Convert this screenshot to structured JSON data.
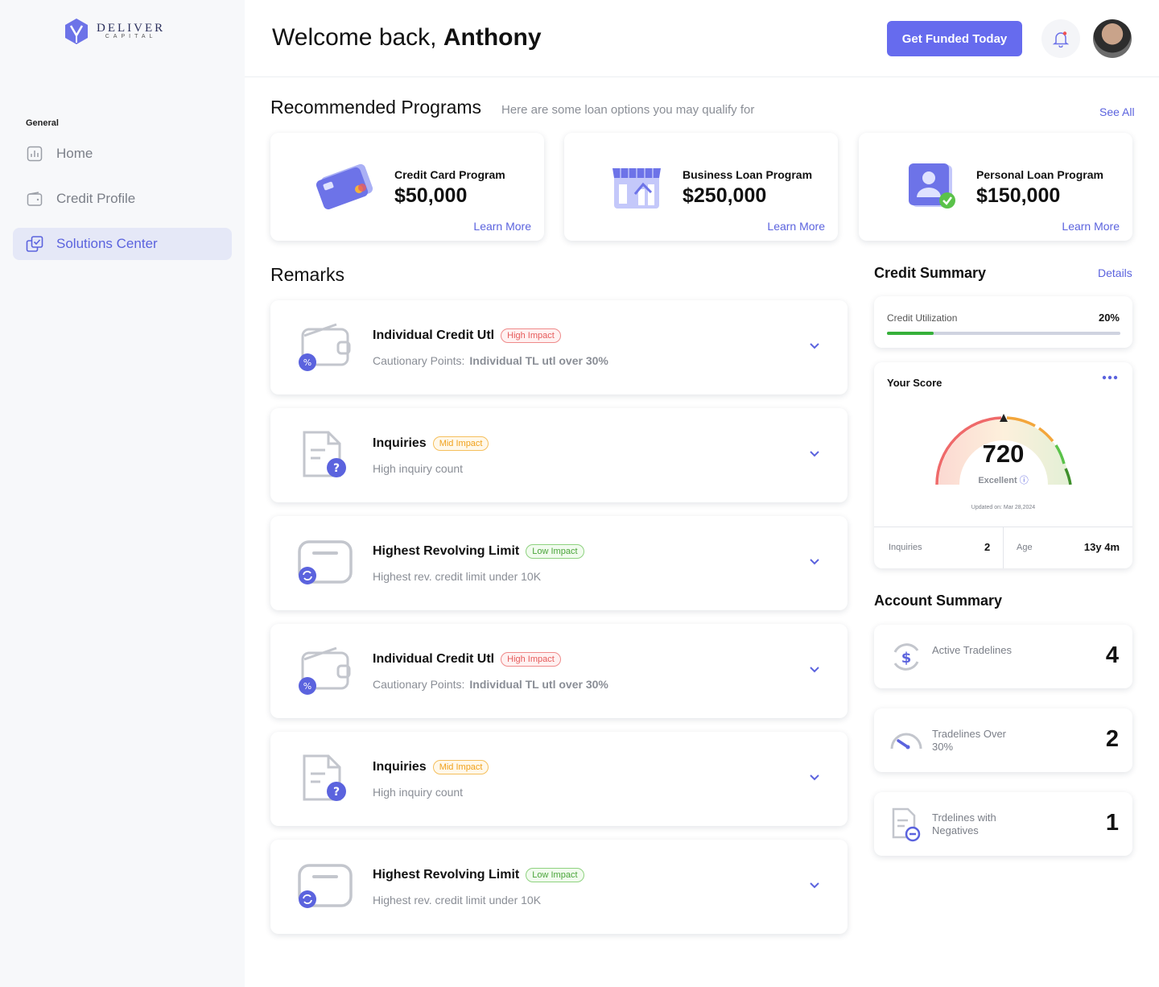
{
  "brand": {
    "name": "DELIVER",
    "sub": "CAPITAL"
  },
  "sidebar": {
    "section": "General",
    "items": [
      {
        "label": "Home",
        "icon": "chart-icon"
      },
      {
        "label": "Credit Profile",
        "icon": "wallet-icon"
      },
      {
        "label": "Solutions Center",
        "icon": "solutions-icon",
        "active": true
      }
    ]
  },
  "header": {
    "welcome": "Welcome back, ",
    "user": "Anthony",
    "cta": "Get Funded Today"
  },
  "programs": {
    "title": "Recommended Programs",
    "subtitle": "Here are some loan options you may qualify for",
    "see_all": "See All",
    "items": [
      {
        "name": "Credit Card Program",
        "amount": "$50,000",
        "link": "Learn More"
      },
      {
        "name": "Business Loan Program",
        "amount": "$250,000",
        "link": "Learn More"
      },
      {
        "name": "Personal Loan Program",
        "amount": "$150,000",
        "link": "Learn More"
      }
    ]
  },
  "remarks": {
    "title": "Remarks",
    "items": [
      {
        "title": "Individual Credit Utl",
        "badge": "High Impact",
        "prefix": "Cautionary Points:",
        "detail": "Individual TL utl over 30%"
      },
      {
        "title": "Inquiries",
        "badge": "Mid Impact",
        "detail": "High inquiry count"
      },
      {
        "title": "Highest Revolving Limit",
        "badge": "Low Impact",
        "detail": "Highest rev. credit limit under 10K"
      },
      {
        "title": "Individual Credit Utl",
        "badge": "High Impact",
        "prefix": "Cautionary Points:",
        "detail": "Individual TL utl over 30%"
      },
      {
        "title": "Inquiries",
        "badge": "Mid Impact",
        "detail": "High inquiry count"
      },
      {
        "title": "Highest Revolving Limit",
        "badge": "Low Impact",
        "detail": "Highest rev. credit limit under 10K"
      }
    ]
  },
  "credit_summary": {
    "title": "Credit Summary",
    "details": "Details",
    "utilization_label": "Credit Utilization",
    "utilization_value": "20%",
    "utilization_fraction": 0.2,
    "score_label": "Your Score",
    "score": "720",
    "rating": "Excellent",
    "updated": "Updated on: Mar 28,2024",
    "inquiries_label": "Inquiries",
    "inquiries": "2",
    "age_label": "Age",
    "age": "13y 4m"
  },
  "account_summary": {
    "title": "Account Summary",
    "items": [
      {
        "label": "Active Tradelines",
        "value": "4"
      },
      {
        "label": "Tradelines Over 30%",
        "value": "2"
      },
      {
        "label": "Trdelines with Negatives",
        "value": "1"
      }
    ]
  },
  "colors": {
    "accent": "#666bee",
    "high": "#e65b5b",
    "mid": "#f0a11a",
    "low": "#4aa53a",
    "progress": "#36b03a"
  }
}
